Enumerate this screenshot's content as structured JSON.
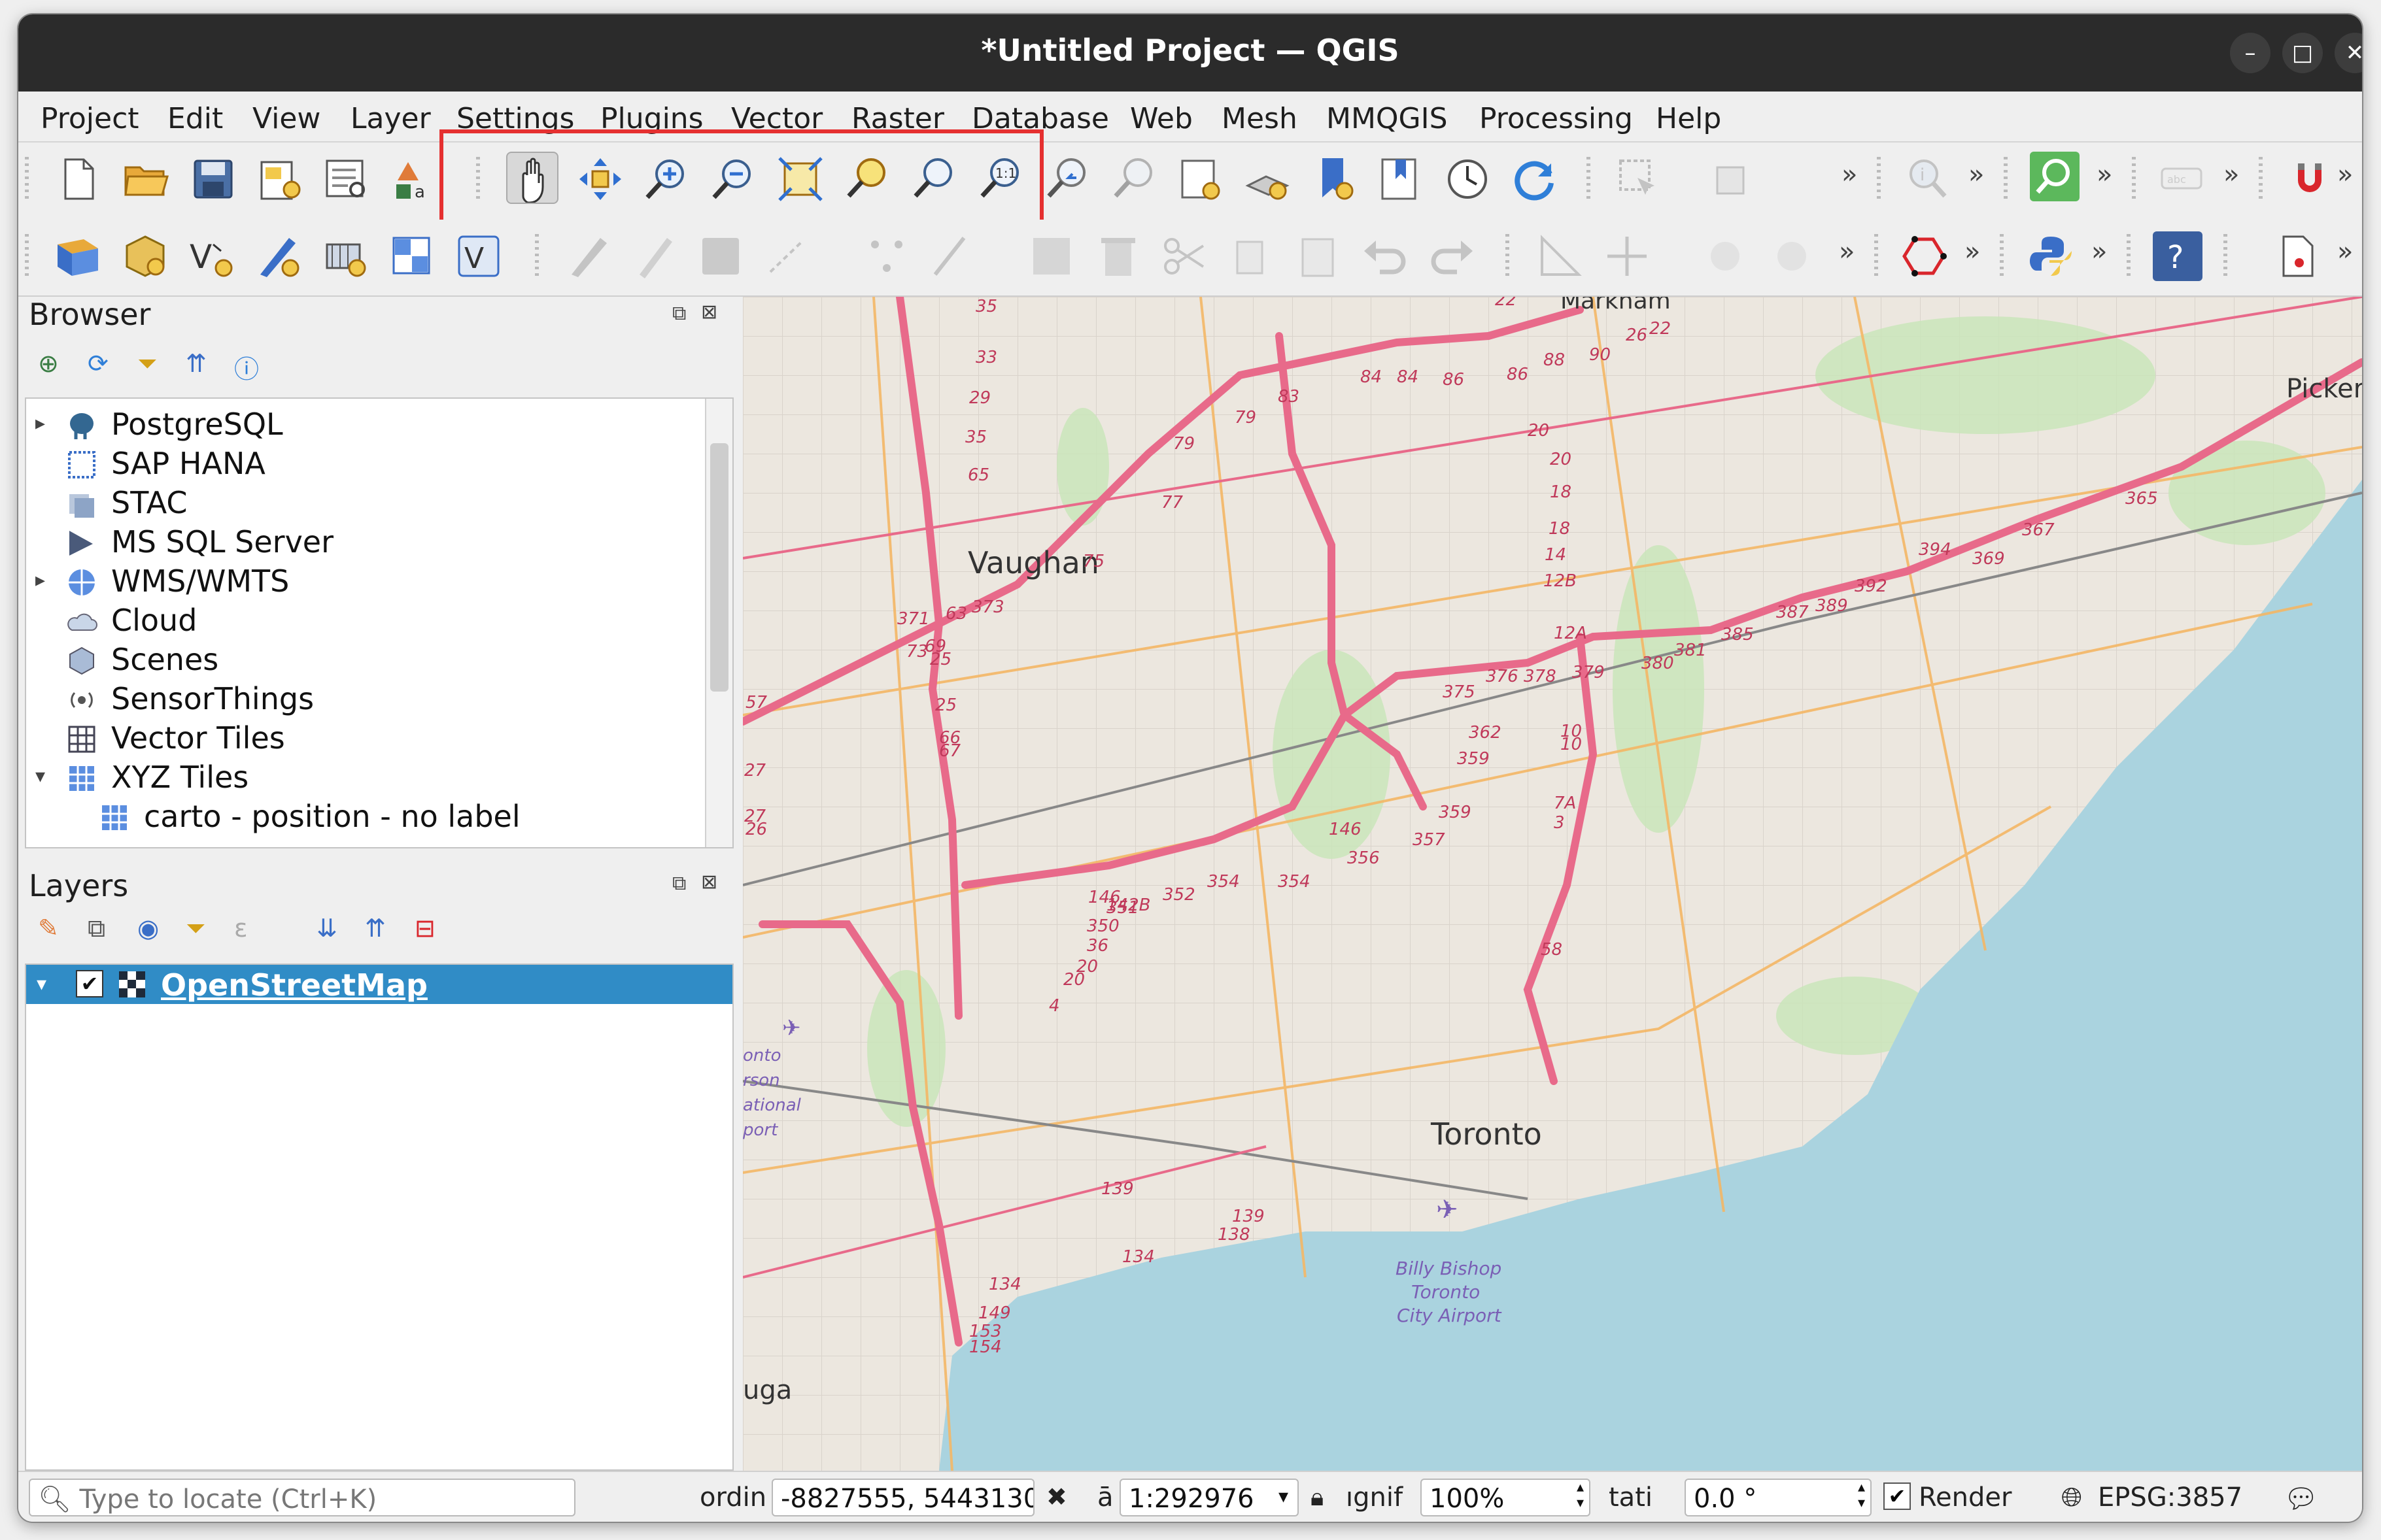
{
  "window": {
    "title": "*Untitled Project — QGIS"
  },
  "menubar": [
    "Project",
    "Edit",
    "View",
    "Layer",
    "Settings",
    "Plugins",
    "Vector",
    "Raster",
    "Database",
    "Web",
    "Mesh",
    "MMQGIS",
    "Processing",
    "Help"
  ],
  "browser": {
    "title": "Browser",
    "items": [
      {
        "label": "PostgreSQL",
        "icon": "postgresql-elephant-icon",
        "expand": "▸"
      },
      {
        "label": "SAP HANA",
        "icon": "sap-hana-icon",
        "expand": ""
      },
      {
        "label": "STAC",
        "icon": "stac-icon",
        "expand": ""
      },
      {
        "label": "MS SQL Server",
        "icon": "mssql-icon",
        "expand": ""
      },
      {
        "label": "WMS/WMTS",
        "icon": "globe-icon",
        "expand": "▸"
      },
      {
        "label": "Cloud",
        "icon": "cloud-icon",
        "expand": ""
      },
      {
        "label": "Scenes",
        "icon": "cube-icon",
        "expand": ""
      },
      {
        "label": "SensorThings",
        "icon": "sensor-icon",
        "expand": ""
      },
      {
        "label": "Vector Tiles",
        "icon": "vector-tiles-icon",
        "expand": ""
      },
      {
        "label": "XYZ Tiles",
        "icon": "xyz-tiles-icon",
        "expand": "▾"
      },
      {
        "label": "carto - position - no label",
        "icon": "tile-layer-icon",
        "expand": ""
      }
    ]
  },
  "layers": {
    "title": "Layers",
    "items": [
      {
        "label": "OpenStreetMap",
        "checked": "✔",
        "expand": "▾"
      }
    ]
  },
  "map_labels": {
    "cities": [
      "Vaughan",
      "Toronto",
      "Pickeri",
      "Markham"
    ],
    "airport": [
      "Billy Bishop",
      "Toronto",
      "City Airport"
    ],
    "pearson": [
      "onto",
      "rson",
      "ational",
      "port"
    ],
    "edge": [
      "uga"
    ],
    "routes": [
      "35",
      "33",
      "29",
      "35",
      "65",
      "63",
      "69",
      "73",
      "75",
      "77",
      "79",
      "79",
      "83",
      "84",
      "84",
      "86",
      "86",
      "88",
      "90",
      "26",
      "22",
      "22",
      "20",
      "20",
      "18",
      "18",
      "14",
      "12B",
      "12A",
      "10",
      "10",
      "7A",
      "3",
      "58",
      "57",
      "27",
      "27",
      "26",
      "25",
      "25",
      "66",
      "67",
      "371",
      "373",
      "375",
      "376",
      "378",
      "379",
      "380",
      "381",
      "385",
      "387",
      "389",
      "392",
      "394",
      "369",
      "367",
      "365",
      "362",
      "359",
      "359",
      "357",
      "356",
      "354",
      "354",
      "352",
      "351",
      "350",
      "36",
      "20",
      "20",
      "4",
      "146",
      "146",
      "142B",
      "139",
      "139",
      "138",
      "134",
      "134",
      "149",
      "153",
      "154"
    ]
  },
  "status": {
    "locate_placeholder": "Type to locate (Ctrl+K)",
    "coord_label": "ordin",
    "coord_value": "-8827555, 5443130",
    "scale_label": "ā",
    "scale_value": "1:292976",
    "magnifier_label": "ıgnif",
    "magnifier_value": "100%",
    "rotation_label": "tati",
    "rotation_value": "0.0 °",
    "render_label": "Render",
    "render_checked": "✔",
    "crs": "EPSG:3857"
  },
  "colors": {
    "accent": "#308cc6",
    "highlight_box": "#e53030",
    "motorway": "#e86a8a",
    "water": "#aad3df",
    "titlebar": "#2b2b2b"
  }
}
